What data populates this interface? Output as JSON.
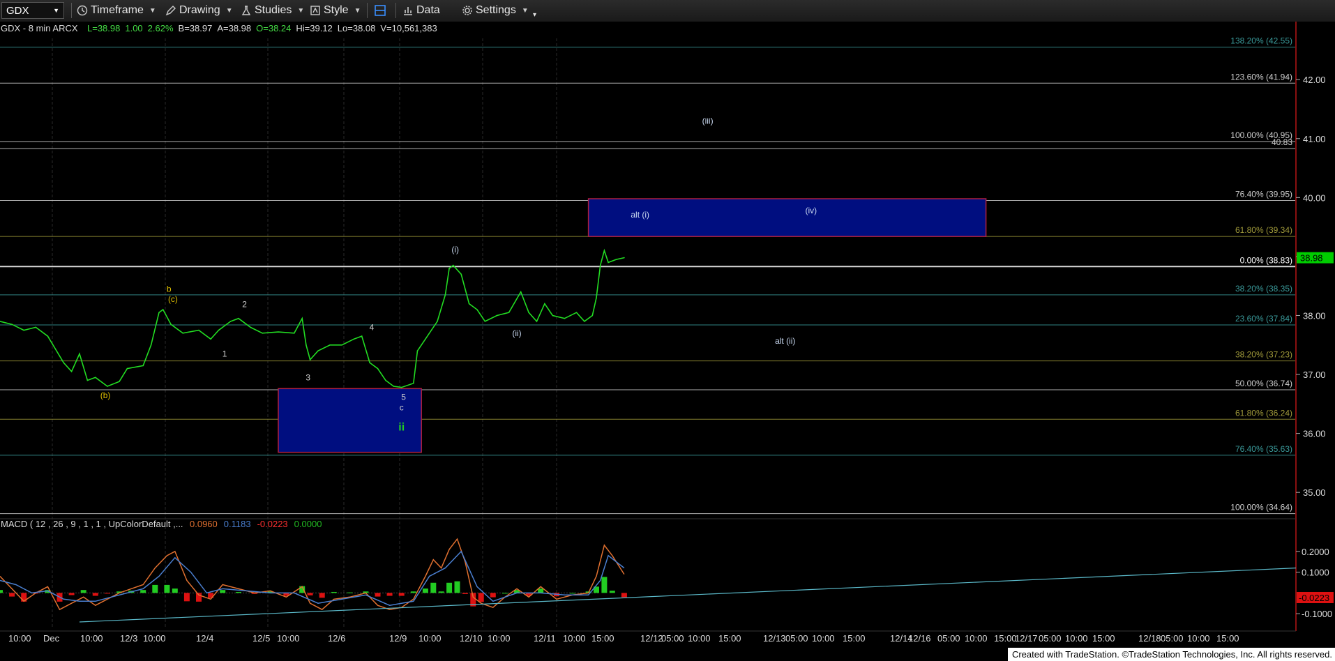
{
  "toolbar": {
    "symbol": "GDX",
    "timeframe": "Timeframe",
    "drawing": "Drawing",
    "studies": "Studies",
    "style": "Style",
    "data": "Data",
    "settings": "Settings"
  },
  "header": {
    "title": "GDX - 8 min  ARCX",
    "fields": [
      {
        "text": "L=38.98",
        "color": "#44dd44"
      },
      {
        "text": "1.00",
        "color": "#44dd44"
      },
      {
        "text": "2.62%",
        "color": "#44dd44"
      },
      {
        "text": "B=38.97",
        "color": "#dddddd"
      },
      {
        "text": "A=38.98",
        "color": "#dddddd"
      },
      {
        "text": "O=38.24",
        "color": "#44dd44"
      },
      {
        "text": "Hi=39.12",
        "color": "#dddddd"
      },
      {
        "text": "Lo=38.08",
        "color": "#dddddd"
      },
      {
        "text": "V=10,561,383",
        "color": "#dddddd"
      }
    ]
  },
  "footer": "Created with TradeStation. ©TradeStation Technologies, Inc. All rights reserved.",
  "chart_data": {
    "type": "line",
    "title": "GDX - 8 min ARCX",
    "price_axis": {
      "ylim": [
        34.6,
        42.7
      ],
      "ticks": [
        "42.00",
        "41.00",
        "40.00",
        "39.00",
        "38.00",
        "37.00",
        "36.00",
        "35.00"
      ],
      "last_price": "38.98",
      "last_price_color": "#00cc00"
    },
    "time_axis_labels": [
      "10:00",
      "Dec",
      "10:00",
      "12/3",
      "10:00",
      "12/4",
      "12/5",
      "10:00",
      "12/6",
      "12/9",
      "10:00",
      "12/10",
      "10:00",
      "12/11",
      "10:00",
      "15:00",
      "12/12",
      "05:00",
      "10:00",
      "15:00",
      "12/13",
      "05:00",
      "10:00",
      "15:00",
      "12/14",
      "12/16",
      "05:00",
      "10:00",
      "15:00",
      "12/17",
      "05:00",
      "10:00",
      "15:00",
      "12/18",
      "05:00",
      "10:00",
      "15:00"
    ],
    "price_series": [
      {
        "x": 0,
        "y": 37.9
      },
      {
        "x": 3,
        "y": 37.85
      },
      {
        "x": 6,
        "y": 37.75
      },
      {
        "x": 9,
        "y": 37.8
      },
      {
        "x": 12,
        "y": 37.65
      },
      {
        "x": 16,
        "y": 37.2
      },
      {
        "x": 18,
        "y": 37.05
      },
      {
        "x": 20,
        "y": 37.35
      },
      {
        "x": 22,
        "y": 36.9
      },
      {
        "x": 24,
        "y": 36.95
      },
      {
        "x": 27,
        "y": 36.8
      },
      {
        "x": 30,
        "y": 36.88
      },
      {
        "x": 32,
        "y": 37.1
      },
      {
        "x": 36,
        "y": 37.15
      },
      {
        "x": 38,
        "y": 37.5
      },
      {
        "x": 40,
        "y": 38.05
      },
      {
        "x": 41,
        "y": 38.1
      },
      {
        "x": 43,
        "y": 37.85
      },
      {
        "x": 46,
        "y": 37.7
      },
      {
        "x": 50,
        "y": 37.75
      },
      {
        "x": 53,
        "y": 37.6
      },
      {
        "x": 55,
        "y": 37.75
      },
      {
        "x": 58,
        "y": 37.9
      },
      {
        "x": 60,
        "y": 37.95
      },
      {
        "x": 63,
        "y": 37.8
      },
      {
        "x": 66,
        "y": 37.7
      },
      {
        "x": 70,
        "y": 37.72
      },
      {
        "x": 74,
        "y": 37.7
      },
      {
        "x": 76,
        "y": 37.95
      },
      {
        "x": 77,
        "y": 37.5
      },
      {
        "x": 78,
        "y": 37.25
      },
      {
        "x": 80,
        "y": 37.4
      },
      {
        "x": 83,
        "y": 37.5
      },
      {
        "x": 86,
        "y": 37.5
      },
      {
        "x": 89,
        "y": 37.6
      },
      {
        "x": 91,
        "y": 37.65
      },
      {
        "x": 93,
        "y": 37.2
      },
      {
        "x": 95,
        "y": 37.1
      },
      {
        "x": 97,
        "y": 36.9
      },
      {
        "x": 99,
        "y": 36.8
      },
      {
        "x": 101,
        "y": 36.78
      },
      {
        "x": 104,
        "y": 36.85
      },
      {
        "x": 105,
        "y": 37.4
      },
      {
        "x": 107,
        "y": 37.6
      },
      {
        "x": 110,
        "y": 37.9
      },
      {
        "x": 112,
        "y": 38.35
      },
      {
        "x": 113,
        "y": 38.8
      },
      {
        "x": 114,
        "y": 38.85
      },
      {
        "x": 116,
        "y": 38.7
      },
      {
        "x": 118,
        "y": 38.2
      },
      {
        "x": 120,
        "y": 38.1
      },
      {
        "x": 122,
        "y": 37.9
      },
      {
        "x": 125,
        "y": 38.0
      },
      {
        "x": 128,
        "y": 38.05
      },
      {
        "x": 131,
        "y": 38.4
      },
      {
        "x": 133,
        "y": 38.05
      },
      {
        "x": 135,
        "y": 37.9
      },
      {
        "x": 137,
        "y": 38.2
      },
      {
        "x": 139,
        "y": 38.0
      },
      {
        "x": 142,
        "y": 37.95
      },
      {
        "x": 145,
        "y": 38.05
      },
      {
        "x": 147,
        "y": 37.9
      },
      {
        "x": 149,
        "y": 38.0
      },
      {
        "x": 150,
        "y": 38.3
      },
      {
        "x": 151,
        "y": 38.85
      },
      {
        "x": 152,
        "y": 39.1
      },
      {
        "x": 153,
        "y": 38.9
      },
      {
        "x": 155,
        "y": 38.95
      },
      {
        "x": 157,
        "y": 38.98
      }
    ],
    "fib_lines": [
      {
        "label": "138.20% (42.55)",
        "y": 42.55,
        "color": "#3a9a9a"
      },
      {
        "label": "123.60% (41.94)",
        "y": 41.94,
        "color": "#cfcfcf"
      },
      {
        "label": "100.00% (40.95)",
        "y": 40.95,
        "color": "#cfcfcf"
      },
      {
        "label": "40.83",
        "y": 40.83,
        "color": "#cfcfcf"
      },
      {
        "label": "76.40% (39.95)",
        "y": 39.95,
        "color": "#cfcfcf"
      },
      {
        "label": "61.80% (39.34)",
        "y": 39.34,
        "color": "#a09a3a"
      },
      {
        "label": "0.00% (38.83)",
        "y": 38.83,
        "color": "#ffffff"
      },
      {
        "label": "38.20% (38.35)",
        "y": 38.35,
        "color": "#3a9a9a"
      },
      {
        "label": "23.60% (37.84)",
        "y": 37.84,
        "color": "#3a9a9a"
      },
      {
        "label": "38.20% (37.23)",
        "y": 37.23,
        "color": "#a09a3a"
      },
      {
        "label": "50.00% (36.74)",
        "y": 36.74,
        "color": "#cfcfcf"
      },
      {
        "label": "61.80% (36.24)",
        "y": 36.24,
        "color": "#a09a3a"
      },
      {
        "label": "76.40% (35.63)",
        "y": 35.63,
        "color": "#3a9a9a"
      },
      {
        "label": "100.00% (34.64)",
        "y": 34.64,
        "color": "#cfcfcf"
      }
    ],
    "zones": [
      {
        "name": "alt-i-zone",
        "x0": 148,
        "x1": 248,
        "y0": 39.34,
        "y1": 39.98,
        "color": "#000e80",
        "border": "#b02040"
      },
      {
        "name": "wave-ii-zone",
        "x0": 70,
        "x1": 106,
        "y0": 35.68,
        "y1": 36.76,
        "color": "#000e80",
        "border": "#b02040"
      }
    ],
    "wave_labels": [
      {
        "text": "b",
        "x": 42.5,
        "y": 38.4,
        "color": "#e0c000"
      },
      {
        "text": "(c)",
        "x": 43.5,
        "y": 38.23,
        "color": "#e0c000"
      },
      {
        "text": "(b)",
        "x": 26.5,
        "y": 36.6,
        "color": "#e0c000"
      },
      {
        "text": "1",
        "x": 56.5,
        "y": 37.3,
        "color": "#cfcfcf"
      },
      {
        "text": "2",
        "x": 61.5,
        "y": 38.14,
        "color": "#cfcfcf"
      },
      {
        "text": "3",
        "x": 77.5,
        "y": 36.9,
        "color": "#cfcfcf"
      },
      {
        "text": "4",
        "x": 93.5,
        "y": 37.75,
        "color": "#cfcfcf"
      },
      {
        "text": "5",
        "x": 101.5,
        "y": 36.57,
        "color": "#cfcfcf"
      },
      {
        "text": "c",
        "x": 101.0,
        "y": 36.39,
        "color": "#cfcfcf"
      },
      {
        "text": "ii",
        "x": 101.0,
        "y": 36.05,
        "color": "#22cc22"
      },
      {
        "text": "(i)",
        "x": 114.5,
        "y": 39.07,
        "color": "#c8d8f0"
      },
      {
        "text": "(ii)",
        "x": 130.0,
        "y": 37.65,
        "color": "#c8d8f0"
      },
      {
        "text": "(iii)",
        "x": 178.0,
        "y": 41.25,
        "color": "#c8d8f0"
      },
      {
        "text": "(iv)",
        "x": 204.0,
        "y": 39.73,
        "color": "#c8d8f0"
      },
      {
        "text": "alt (i)",
        "x": 161.0,
        "y": 39.66,
        "color": "#c8d8f0"
      },
      {
        "text": "alt (ii)",
        "x": 197.5,
        "y": 37.52,
        "color": "#c8d8f0"
      }
    ],
    "macd": {
      "label": "MACD ( 12 , 26 , 9 , 1 , 1 , UpColorDefault ,...",
      "values": [
        {
          "text": "0.0960",
          "color": "#e07030"
        },
        {
          "text": "0.1183",
          "color": "#4a7fd0"
        },
        {
          "text": "-0.0223",
          "color": "#ff3030"
        },
        {
          "text": "0.0000",
          "color": "#22bb22"
        }
      ],
      "ylim": [
        -0.15,
        0.27
      ],
      "ticks": [
        "0.2000",
        "0.1000",
        "-0.1000"
      ],
      "last_value": "-0.0223",
      "trendline": [
        {
          "x": 20,
          "y": -0.14
        },
        {
          "x": 340,
          "y": 0.12
        }
      ],
      "macd_line": [
        {
          "x": 0,
          "y": 0.08
        },
        {
          "x": 3,
          "y": 0.02
        },
        {
          "x": 6,
          "y": -0.04
        },
        {
          "x": 9,
          "y": 0.0
        },
        {
          "x": 12,
          "y": 0.03
        },
        {
          "x": 15,
          "y": -0.08
        },
        {
          "x": 18,
          "y": -0.05
        },
        {
          "x": 21,
          "y": -0.02
        },
        {
          "x": 24,
          "y": -0.06
        },
        {
          "x": 27,
          "y": -0.03
        },
        {
          "x": 30,
          "y": 0.0
        },
        {
          "x": 33,
          "y": 0.02
        },
        {
          "x": 36,
          "y": 0.04
        },
        {
          "x": 39,
          "y": 0.12
        },
        {
          "x": 42,
          "y": 0.18
        },
        {
          "x": 44,
          "y": 0.2
        },
        {
          "x": 47,
          "y": 0.06
        },
        {
          "x": 50,
          "y": -0.01
        },
        {
          "x": 53,
          "y": -0.03
        },
        {
          "x": 56,
          "y": 0.04
        },
        {
          "x": 60,
          "y": 0.02
        },
        {
          "x": 64,
          "y": 0.0
        },
        {
          "x": 68,
          "y": 0.01
        },
        {
          "x": 72,
          "y": -0.02
        },
        {
          "x": 76,
          "y": 0.03
        },
        {
          "x": 78,
          "y": -0.05
        },
        {
          "x": 81,
          "y": -0.08
        },
        {
          "x": 84,
          "y": -0.03
        },
        {
          "x": 88,
          "y": -0.02
        },
        {
          "x": 92,
          "y": 0.0
        },
        {
          "x": 95,
          "y": -0.06
        },
        {
          "x": 98,
          "y": -0.08
        },
        {
          "x": 101,
          "y": -0.07
        },
        {
          "x": 104,
          "y": -0.03
        },
        {
          "x": 107,
          "y": 0.08
        },
        {
          "x": 109,
          "y": 0.16
        },
        {
          "x": 111,
          "y": 0.12
        },
        {
          "x": 113,
          "y": 0.21
        },
        {
          "x": 115,
          "y": 0.26
        },
        {
          "x": 117,
          "y": 0.15
        },
        {
          "x": 119,
          "y": -0.02
        },
        {
          "x": 121,
          "y": -0.05
        },
        {
          "x": 124,
          "y": -0.07
        },
        {
          "x": 127,
          "y": -0.02
        },
        {
          "x": 130,
          "y": 0.02
        },
        {
          "x": 133,
          "y": -0.02
        },
        {
          "x": 136,
          "y": 0.03
        },
        {
          "x": 140,
          "y": -0.03
        },
        {
          "x": 144,
          "y": -0.01
        },
        {
          "x": 148,
          "y": 0.0
        },
        {
          "x": 150,
          "y": 0.08
        },
        {
          "x": 152,
          "y": 0.23
        },
        {
          "x": 154,
          "y": 0.18
        },
        {
          "x": 157,
          "y": 0.09
        }
      ],
      "signal_line": [
        {
          "x": 0,
          "y": 0.06
        },
        {
          "x": 4,
          "y": 0.04
        },
        {
          "x": 8,
          "y": 0.0
        },
        {
          "x": 12,
          "y": 0.01
        },
        {
          "x": 16,
          "y": -0.03
        },
        {
          "x": 20,
          "y": -0.04
        },
        {
          "x": 24,
          "y": -0.04
        },
        {
          "x": 28,
          "y": -0.02
        },
        {
          "x": 32,
          "y": 0.0
        },
        {
          "x": 36,
          "y": 0.02
        },
        {
          "x": 40,
          "y": 0.08
        },
        {
          "x": 44,
          "y": 0.17
        },
        {
          "x": 48,
          "y": 0.1
        },
        {
          "x": 52,
          "y": 0.0
        },
        {
          "x": 56,
          "y": 0.02
        },
        {
          "x": 62,
          "y": 0.01
        },
        {
          "x": 68,
          "y": 0.0
        },
        {
          "x": 74,
          "y": 0.0
        },
        {
          "x": 80,
          "y": -0.05
        },
        {
          "x": 86,
          "y": -0.03
        },
        {
          "x": 92,
          "y": -0.01
        },
        {
          "x": 98,
          "y": -0.06
        },
        {
          "x": 104,
          "y": -0.04
        },
        {
          "x": 108,
          "y": 0.08
        },
        {
          "x": 112,
          "y": 0.12
        },
        {
          "x": 116,
          "y": 0.2
        },
        {
          "x": 120,
          "y": 0.03
        },
        {
          "x": 124,
          "y": -0.04
        },
        {
          "x": 130,
          "y": 0.0
        },
        {
          "x": 136,
          "y": 0.0
        },
        {
          "x": 142,
          "y": -0.01
        },
        {
          "x": 148,
          "y": -0.01
        },
        {
          "x": 151,
          "y": 0.06
        },
        {
          "x": 153,
          "y": 0.18
        },
        {
          "x": 157,
          "y": 0.12
        }
      ]
    }
  }
}
